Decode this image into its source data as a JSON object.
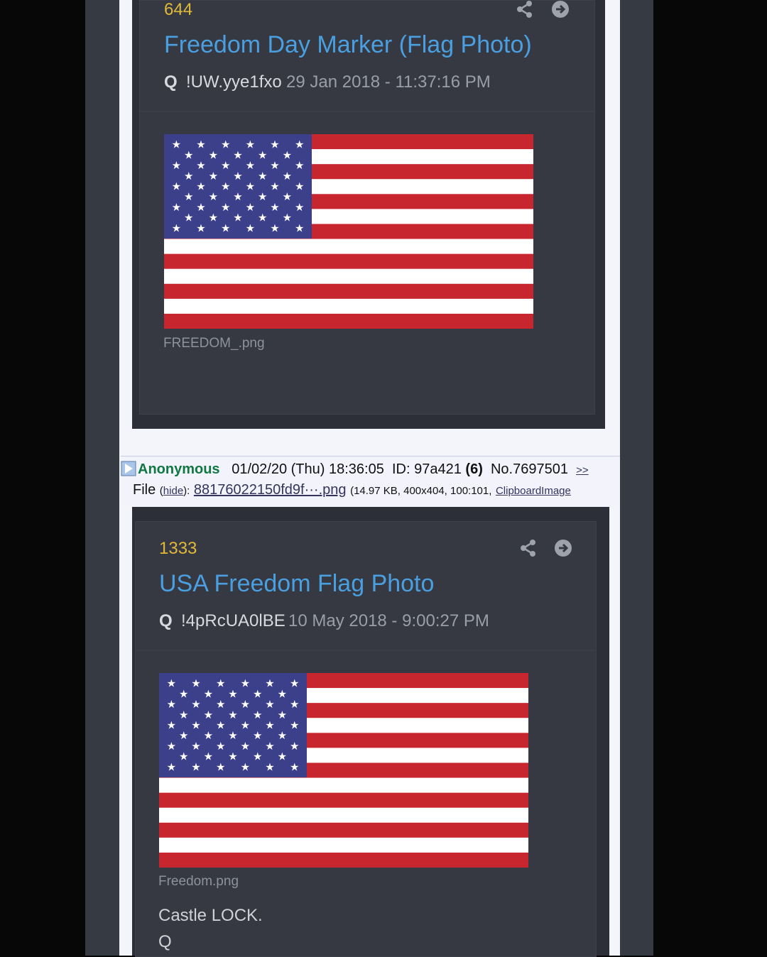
{
  "post1": {
    "number": "644",
    "title": "Freedom Day Marker (Flag Photo)",
    "author": "Q",
    "tripcode": "!UW.yye1fxo",
    "date": "29 Jan 2018 - 11:37:16 PM",
    "filename": "FREEDOM_.png"
  },
  "chan_post": {
    "name": "Anonymous",
    "datetime": "01/02/20 (Thu) 18:36:05",
    "id_label": "ID:",
    "id_value": "97a421",
    "id_count": "(6)",
    "post_no": "No.7697501",
    "reply_link": ">>",
    "file_label": "File",
    "hide_link": "hide",
    "filename_link": "88176022150fd9f···.png",
    "file_meta": "(14.97 KB, 400x404, 100:101,",
    "clipboard_link": "ClipboardImage"
  },
  "post2": {
    "number": "1333",
    "title": "USA Freedom Flag Photo",
    "author": "Q",
    "tripcode": "!4pRcUA0lBE",
    "date": "10 May 2018 - 9:00:27 PM",
    "filename": "Freedom.png",
    "body_line1": "Castle LOCK.",
    "body_line2": "Q"
  },
  "icons": [
    "share-icon",
    "arrow-circle-right-icon",
    "expand-arrow-icon"
  ],
  "colors": {
    "post_number": "#e0b83a",
    "post_title": "#4a9fe0",
    "anon_name": "#117743",
    "flag_red": "#c8262e",
    "flag_blue": "#3c3f8a"
  }
}
